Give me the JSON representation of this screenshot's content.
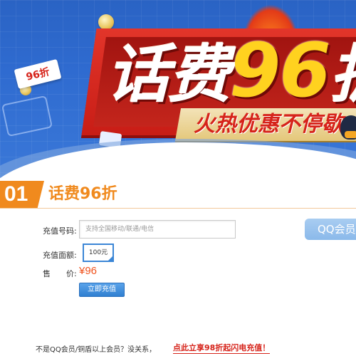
{
  "banner": {
    "headline_text": "话费",
    "headline_number": "96",
    "headline_tail": "折",
    "slogan": "火热优惠不停歇",
    "tag": "96折"
  },
  "section": {
    "number": "01",
    "title": "话费96折"
  },
  "form": {
    "phone_label": "充值号码:",
    "phone_placeholder": "支持全国移动/联通/电信",
    "amount_label": "充值面额:",
    "amount_selected": "100元",
    "price_label": "售　　价:",
    "price_value": "¥96",
    "submit_label": "立即充值"
  },
  "qq_button": {
    "label": "QQ会员"
  },
  "footer": {
    "plain_text": "不是QQ会员/铜盾以上会员？没关系，",
    "link_text": "点此立享98折起闪电充值！"
  },
  "colors": {
    "banner_blue": "#2f6bd0",
    "accent_orange": "#f08a1e",
    "price_red": "#f0531e",
    "link_red": "#d6231a",
    "button_blue": "#2f7fd1"
  }
}
